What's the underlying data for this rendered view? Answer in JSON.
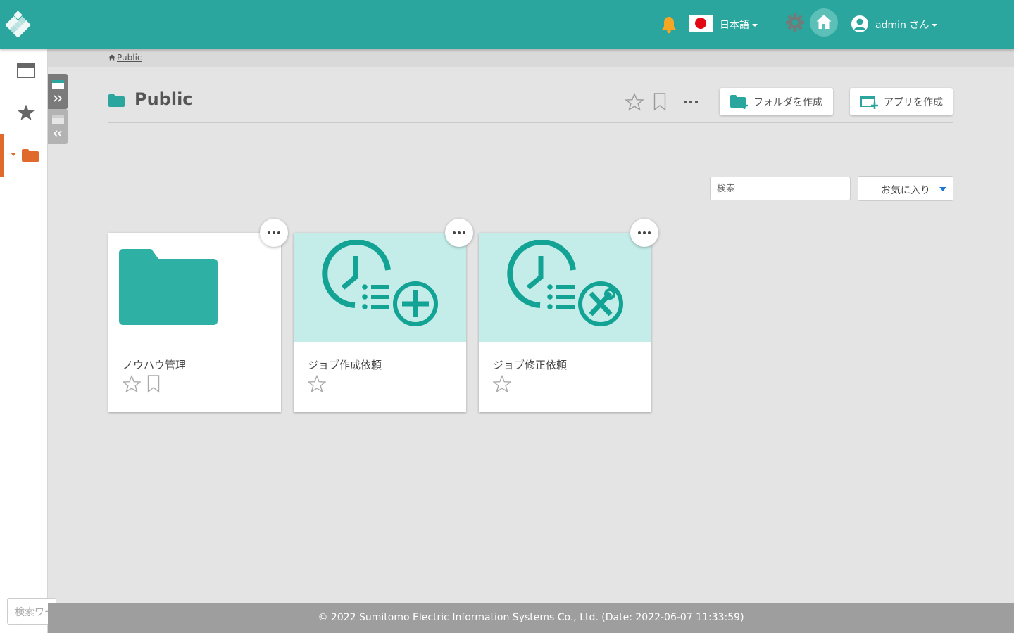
{
  "header": {
    "language_label": "日本語",
    "user_label": "admin さん",
    "colors": {
      "bar": "#2aa69e",
      "bell": "#f5a623",
      "flag_red": "#e30613"
    }
  },
  "sidebar": {
    "items": [
      {
        "icon": "window-icon",
        "active": false
      },
      {
        "icon": "star-icon",
        "active": false
      },
      {
        "icon": "folder-icon",
        "active": true,
        "accent": "#e06a2c"
      }
    ],
    "search_placeholder": "検索ワード"
  },
  "breadcrumb": {
    "home_label": "Public"
  },
  "page": {
    "title": "Public",
    "create_folder_label": "フォルダを作成",
    "create_app_label": "アプリを作成"
  },
  "toolbar": {
    "search_placeholder": "検索",
    "filter_selected": "お気に入り"
  },
  "cards": [
    {
      "name": "ノウハウ管理",
      "type": "folder",
      "icon": "folder-icon",
      "bookmark": true
    },
    {
      "name": "ジョブ作成依頼",
      "type": "app",
      "icon": "clock-list-plus-icon",
      "bookmark": false
    },
    {
      "name": "ジョブ修正依頼",
      "type": "app",
      "icon": "clock-list-tools-icon",
      "bookmark": false
    }
  ],
  "footer": {
    "copyright": "© 2022 Sumitomo Electric Information Systems Co., Ltd. (Date: 2022-06-07 11:33:59)"
  }
}
